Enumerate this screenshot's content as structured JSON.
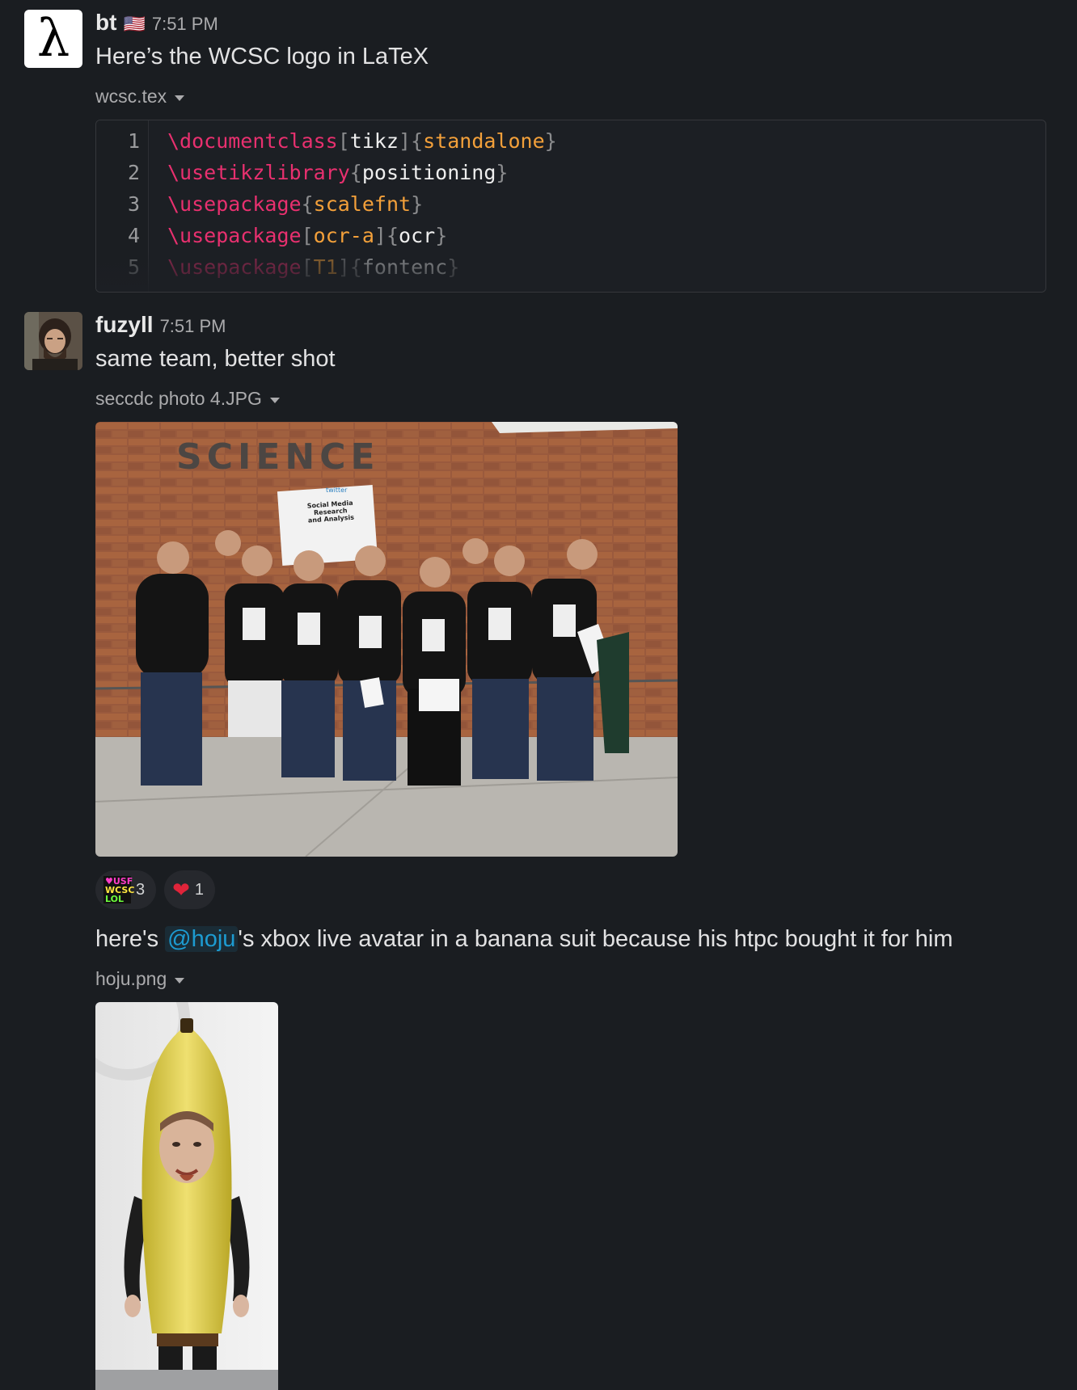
{
  "messages": [
    {
      "avatar": "lambda-avatar",
      "avatar_glyph": "λ",
      "username": "bt",
      "flag": "🇺🇸",
      "time": "7:51 PM",
      "text": "Here’s the WCSC logo in LaTeX",
      "attachment": {
        "filename": "wcsc.tex",
        "code_lines": [
          {
            "n": "1",
            "tokens": [
              [
                "cmd",
                "\\documentclass"
              ],
              [
                "brk",
                "["
              ],
              [
                "arg",
                "tikz"
              ],
              [
                "brk",
                "]"
              ],
              [
                "brk",
                "{"
              ],
              [
                "opt",
                "standalone"
              ],
              [
                "brk",
                "}"
              ]
            ]
          },
          {
            "n": "2",
            "tokens": [
              [
                "cmd",
                "\\usetikzlibrary"
              ],
              [
                "brk",
                "{"
              ],
              [
                "arg",
                "positioning"
              ],
              [
                "brk",
                "}"
              ]
            ]
          },
          {
            "n": "3",
            "tokens": [
              [
                "cmd",
                "\\usepackage"
              ],
              [
                "brk",
                "{"
              ],
              [
                "opt",
                "scalefnt"
              ],
              [
                "brk",
                "}"
              ]
            ]
          },
          {
            "n": "4",
            "tokens": [
              [
                "cmd",
                "\\usepackage"
              ],
              [
                "brk",
                "["
              ],
              [
                "opt",
                "ocr-a"
              ],
              [
                "brk",
                "]"
              ],
              [
                "brk",
                "{"
              ],
              [
                "arg",
                "ocr"
              ],
              [
                "brk",
                "}"
              ]
            ]
          },
          {
            "n": "5",
            "tokens": [
              [
                "cmd",
                "\\usepackage"
              ],
              [
                "brk",
                "["
              ],
              [
                "opt",
                "T1"
              ],
              [
                "brk",
                "]"
              ],
              [
                "brk",
                "{"
              ],
              [
                "arg",
                "fontenc"
              ],
              [
                "brk",
                "}"
              ]
            ]
          }
        ]
      }
    },
    {
      "avatar": "user-photo-avatar",
      "username": "fuzyll",
      "time": "7:51 PM",
      "text": "same team, better shot",
      "attachment": {
        "filename": "seccdc photo 4.JPG",
        "photo_sign": "SCIENCE",
        "poster_text": "Social Media Research and Analysis",
        "poster_brand": "twitter"
      },
      "reactions": [
        {
          "emoji": "wcsc-custom-emoji",
          "emoji_text": [
            "♥USF",
            "WCSC",
            "LOL"
          ],
          "count": "3"
        },
        {
          "emoji": "heart-emoji",
          "emoji_text": [
            "❤"
          ],
          "count": "1"
        }
      ]
    },
    {
      "text_before": "here's ",
      "mention": "@hoju",
      "text_after": "'s xbox live avatar in a banana suit because his htpc bought it for him",
      "attachment": {
        "filename": "hoju.png"
      }
    }
  ],
  "colors": {
    "background": "#1a1d21",
    "command": "#e8306f",
    "option": "#f3a03a",
    "mention": "#1d9bd1"
  }
}
